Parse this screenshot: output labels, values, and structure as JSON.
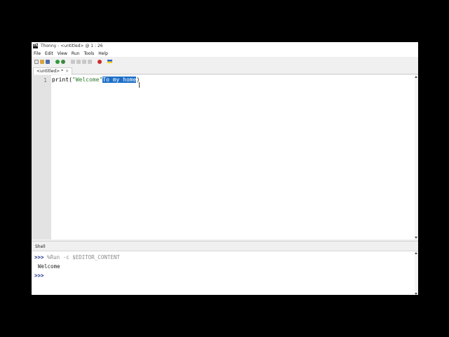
{
  "window": {
    "app_name": "Thonny",
    "title": "Thonny  -  <untitled>  @  1 : 26"
  },
  "menu": [
    "File",
    "Edit",
    "View",
    "Run",
    "Tools",
    "Help"
  ],
  "toolbar": {
    "icons": [
      "new-file-icon",
      "open-file-icon",
      "save-icon",
      "run-icon",
      "debug-icon",
      "step-over-icon",
      "step-into-icon",
      "step-out-icon",
      "resume-icon",
      "stop-icon",
      "support-ukraine-icon"
    ]
  },
  "tabs": [
    {
      "label": "<untitled> *",
      "close": "×"
    }
  ],
  "editor": {
    "line_number": "1",
    "code_prefix": "print(",
    "code_string": "\"Welcome\"",
    "code_selected": "To my home",
    "code_suffix": ")",
    "selection_color": "#1c6fc7",
    "string_color": "#2c7d2c"
  },
  "shell": {
    "label": "Shell",
    "prompt": ">>>",
    "command": " %Run -c $EDITOR_CONTENT",
    "output": "Welcome",
    "prompt2": ">>>"
  }
}
